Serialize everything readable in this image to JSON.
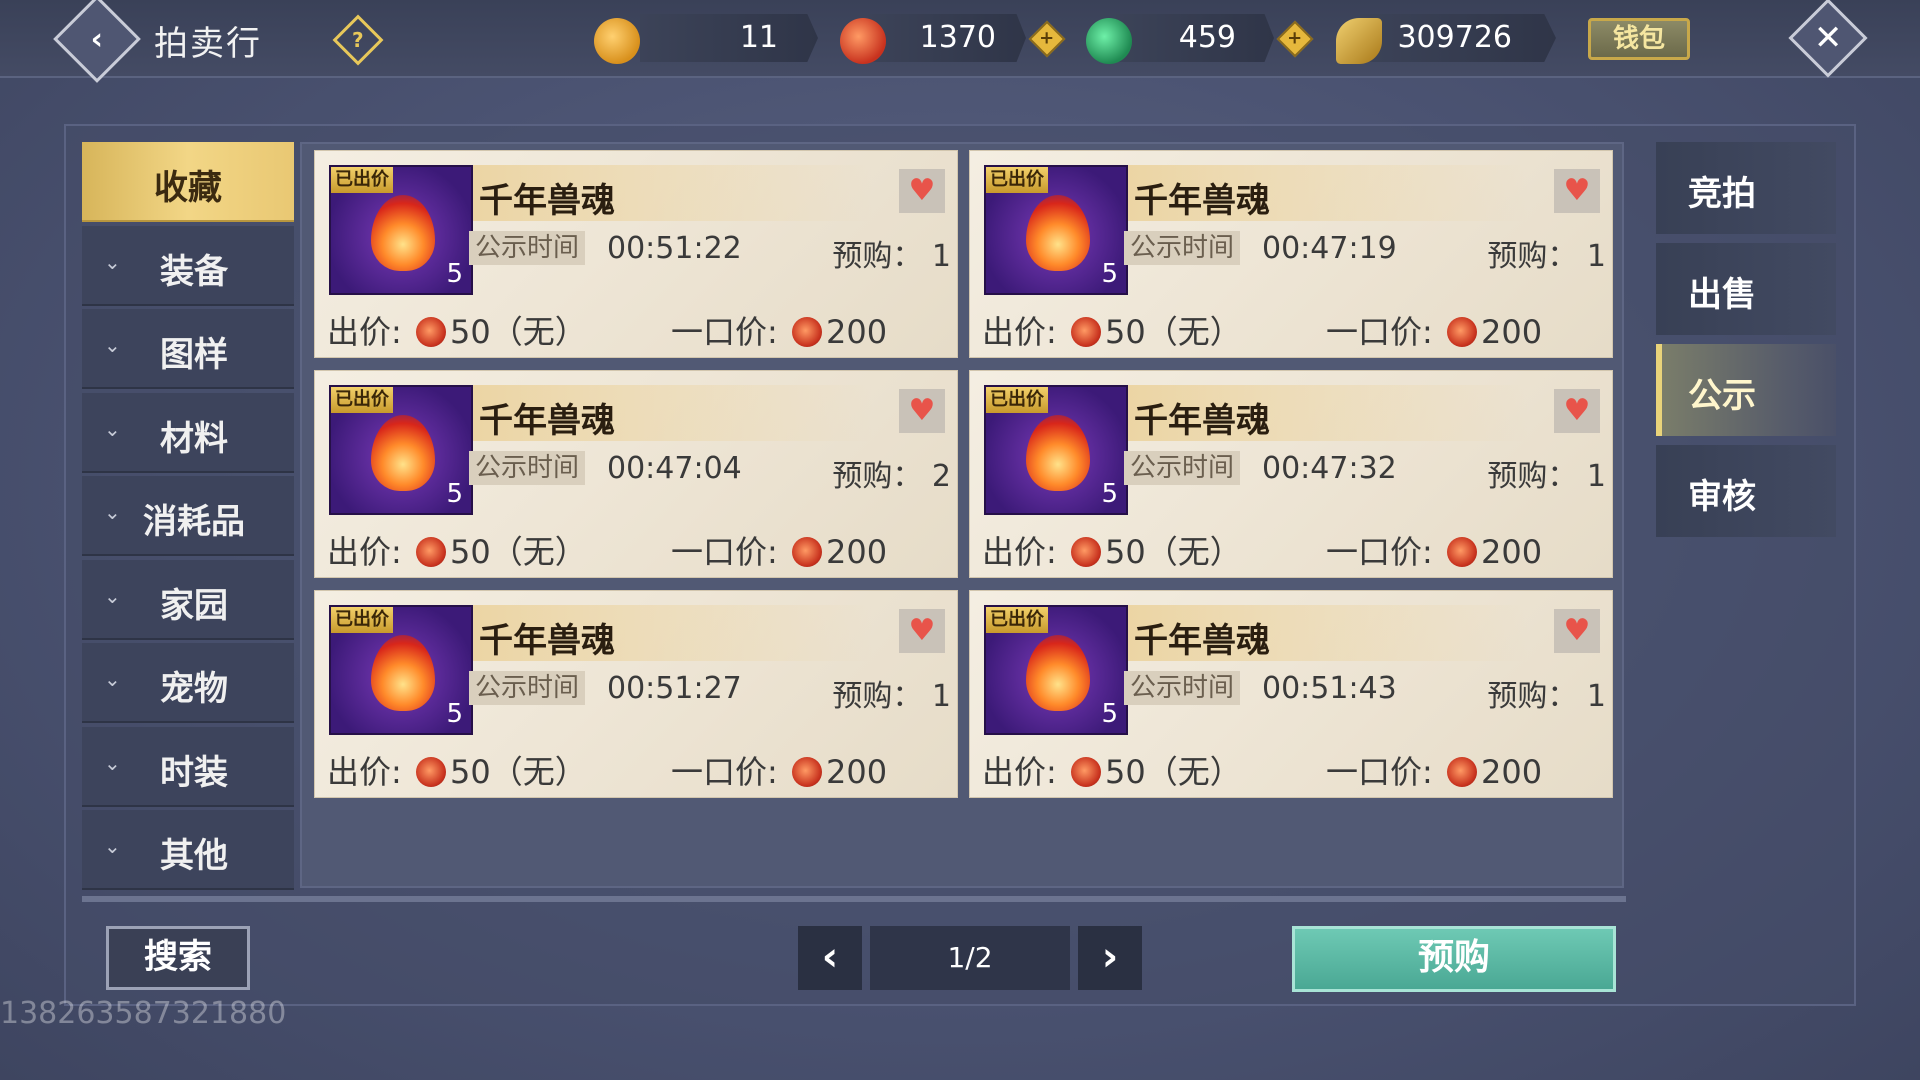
{
  "header": {
    "title": "拍卖行",
    "currencies": [
      {
        "name": "gold-lock",
        "value": "11",
        "color": "#e0a024"
      },
      {
        "name": "red-coin",
        "value": "1370",
        "color": "#c8321e"
      },
      {
        "name": "jade",
        "value": "459",
        "color": "#2fb070"
      },
      {
        "name": "gold-leaf",
        "value": "309726",
        "color": "#c8a030"
      }
    ],
    "wallet_label": "钱包"
  },
  "categories": [
    {
      "label": "收藏",
      "active": true
    },
    {
      "label": "装备",
      "active": false
    },
    {
      "label": "图样",
      "active": false
    },
    {
      "label": "材料",
      "active": false
    },
    {
      "label": "消耗品",
      "active": false
    },
    {
      "label": "家园",
      "active": false
    },
    {
      "label": "宠物",
      "active": false
    },
    {
      "label": "时装",
      "active": false
    },
    {
      "label": "其他",
      "active": false
    }
  ],
  "items": [
    {
      "badge": "已出价",
      "qty": "5",
      "name": "千年兽魂",
      "time_label": "公示时间",
      "time": "00:51:22",
      "preorder": "预购： 1",
      "bid": "出价: ",
      "bid_value": "50（无）",
      "buyout": "一口价: ",
      "buyout_value": "200"
    },
    {
      "badge": "已出价",
      "qty": "5",
      "name": "千年兽魂",
      "time_label": "公示时间",
      "time": "00:47:19",
      "preorder": "预购： 1",
      "bid": "出价: ",
      "bid_value": "50（无）",
      "buyout": "一口价: ",
      "buyout_value": "200"
    },
    {
      "badge": "已出价",
      "qty": "5",
      "name": "千年兽魂",
      "time_label": "公示时间",
      "time": "00:47:04",
      "preorder": "预购： 2",
      "bid": "出价: ",
      "bid_value": "50（无）",
      "buyout": "一口价: ",
      "buyout_value": "200"
    },
    {
      "badge": "已出价",
      "qty": "5",
      "name": "千年兽魂",
      "time_label": "公示时间",
      "time": "00:47:32",
      "preorder": "预购： 1",
      "bid": "出价: ",
      "bid_value": "50（无）",
      "buyout": "一口价: ",
      "buyout_value": "200"
    },
    {
      "badge": "已出价",
      "qty": "5",
      "name": "千年兽魂",
      "time_label": "公示时间",
      "time": "00:51:27",
      "preorder": "预购： 1",
      "bid": "出价: ",
      "bid_value": "50（无）",
      "buyout": "一口价: ",
      "buyout_value": "200"
    },
    {
      "badge": "已出价",
      "qty": "5",
      "name": "千年兽魂",
      "time_label": "公示时间",
      "time": "00:51:43",
      "preorder": "预购： 1",
      "bid": "出价: ",
      "bid_value": "50（无）",
      "buyout": "一口价: ",
      "buyout_value": "200"
    }
  ],
  "tabs": [
    {
      "label": "竞拍",
      "active": false
    },
    {
      "label": "出售",
      "active": false
    },
    {
      "label": "公示",
      "active": true
    },
    {
      "label": "审核",
      "active": false
    }
  ],
  "footer": {
    "search_label": "搜索",
    "page": "1/2",
    "preorder_label": "预购",
    "user_id": "138263587321880"
  }
}
